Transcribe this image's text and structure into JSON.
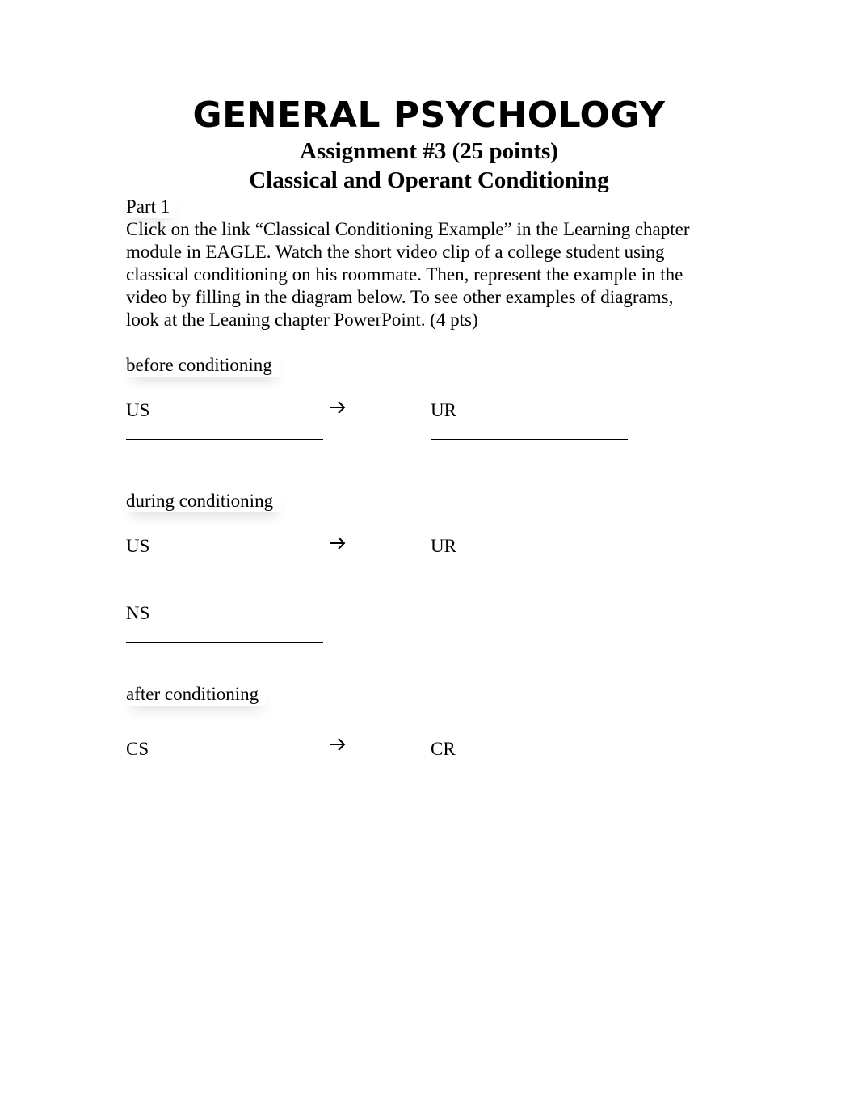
{
  "header": {
    "course_title": "GENERAL PSYCHOLOGY",
    "assignment": "Assignment #3 (25 points)",
    "topic": "Classical and Operant Conditioning"
  },
  "part1": {
    "label": "Part 1",
    "instructions_lines": [
      "Click on the link “Classical Conditioning Example” in the Learning chapter",
      "module in EAGLE.  Watch the short video clip of a college student using",
      "classical conditioning on his roommate.  Then, represent the example in the",
      "video by filling in the diagram below. To see other examples of diagrams,",
      "look at the Leaning chapter PowerPoint. (4 pts)"
    ]
  },
  "diagram": {
    "arrow_icon": "right-arrow-icon",
    "sections": [
      {
        "label": "before conditioning",
        "rows": [
          {
            "left_term": "US",
            "right_term": "UR",
            "left_answer": "",
            "right_answer": ""
          }
        ]
      },
      {
        "label": "during conditioning",
        "rows": [
          {
            "left_term": "US",
            "right_term": "UR",
            "left_answer": "",
            "right_answer": ""
          },
          {
            "left_term": "NS",
            "left_answer": ""
          }
        ]
      },
      {
        "label": "after conditioning",
        "rows": [
          {
            "left_term": "CS",
            "right_term": "CR",
            "left_answer": "",
            "right_answer": ""
          }
        ]
      }
    ]
  }
}
